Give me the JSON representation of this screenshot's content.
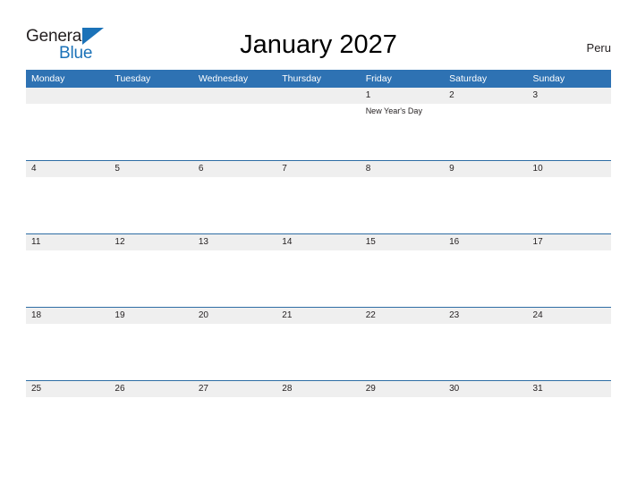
{
  "brand": {
    "name_top": "General",
    "name_bottom": "Blue",
    "flag_icon": "blue-triangle-flag-icon",
    "color_dark": "#231f20",
    "color_blue": "#1b72b8"
  },
  "header": {
    "title": "January 2027",
    "month": "January",
    "year": "2027",
    "country": "Peru"
  },
  "colors": {
    "header_blue": "#2e72b3",
    "rule_blue": "#2e6da4",
    "date_band_gray": "#efefef",
    "text_dark": "#231f20",
    "page_background": "#ffffff"
  },
  "calendar": {
    "weekdays": [
      "Monday",
      "Tuesday",
      "Wednesday",
      "Thursday",
      "Friday",
      "Saturday",
      "Sunday"
    ],
    "weeks": [
      {
        "dates": [
          "",
          "",
          "",
          "",
          "1",
          "2",
          "3"
        ],
        "events": [
          "",
          "",
          "",
          "",
          "New Year's Day",
          "",
          ""
        ]
      },
      {
        "dates": [
          "4",
          "5",
          "6",
          "7",
          "8",
          "9",
          "10"
        ],
        "events": [
          "",
          "",
          "",
          "",
          "",
          "",
          ""
        ]
      },
      {
        "dates": [
          "11",
          "12",
          "13",
          "14",
          "15",
          "16",
          "17"
        ],
        "events": [
          "",
          "",
          "",
          "",
          "",
          "",
          ""
        ]
      },
      {
        "dates": [
          "18",
          "19",
          "20",
          "21",
          "22",
          "23",
          "24"
        ],
        "events": [
          "",
          "",
          "",
          "",
          "",
          "",
          ""
        ]
      },
      {
        "dates": [
          "25",
          "26",
          "27",
          "28",
          "29",
          "30",
          "31"
        ],
        "events": [
          "",
          "",
          "",
          "",
          "",
          "",
          ""
        ]
      }
    ]
  }
}
